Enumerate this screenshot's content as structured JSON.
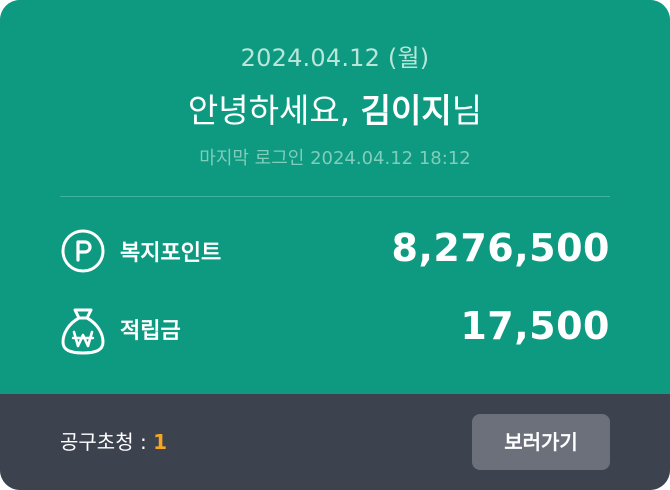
{
  "header": {
    "date": "2024.04.12 (월)",
    "greeting_prefix": "안녕하세요, ",
    "user_name": "김이지",
    "greeting_suffix": "님",
    "last_login": "마지막 로그인 2024.04.12 18:12"
  },
  "balances": {
    "points": {
      "icon": "p-circle-icon",
      "label": "복지포인트",
      "value": "8,276,500"
    },
    "reserve": {
      "icon": "won-money-bag-icon",
      "label": "적립금",
      "value": "17,500"
    }
  },
  "footer": {
    "group_invite_label": "공구초청 : ",
    "group_invite_count": "1",
    "view_button_label": "보러가기"
  },
  "colors": {
    "card_background": "#0d9a80",
    "footer_background": "#3d424f",
    "button_background": "#6b707a",
    "count_accent": "#f5a623"
  }
}
